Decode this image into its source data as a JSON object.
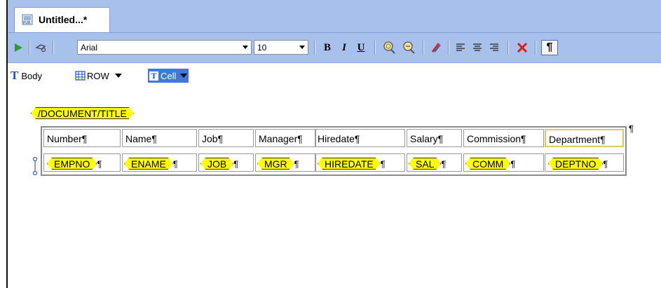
{
  "window": {
    "tab_title": "Untitled...*",
    "tab_icon": "publisher-document-icon"
  },
  "toolbar": {
    "font_name": "Arial",
    "font_size": "10",
    "bold_label": "B",
    "italic_label": "I",
    "underline_label": "U",
    "pilcrow_label": "¶",
    "icons": [
      "run-icon",
      "tool-icon",
      "find-icon",
      "zoom-icon",
      "highlighter-icon",
      "align-left-icon",
      "align-center-icon",
      "align-right-icon",
      "delete-icon"
    ],
    "colors": {
      "run": "#2e9a2e",
      "delete": "#e01818",
      "accent": "#a8c1ec"
    }
  },
  "format_bar": {
    "body_label": "Body",
    "row_label": "ROW",
    "cell_label": "Cell"
  },
  "document": {
    "title_tag": "/DOCUMENT/TITLE",
    "headers": [
      "Number¶",
      "Name¶",
      "Job¶",
      "Manager¶",
      "Hiredate¶",
      "Salary¶",
      "Commission¶",
      "Department¶"
    ],
    "fields": [
      "EMPNO",
      "ENAME",
      "JOB",
      "MGR",
      "HIREDATE",
      "SAL",
      "COMM",
      "DEPTNO"
    ],
    "pilcrow": "¶",
    "tag_color": "#ffff00"
  }
}
